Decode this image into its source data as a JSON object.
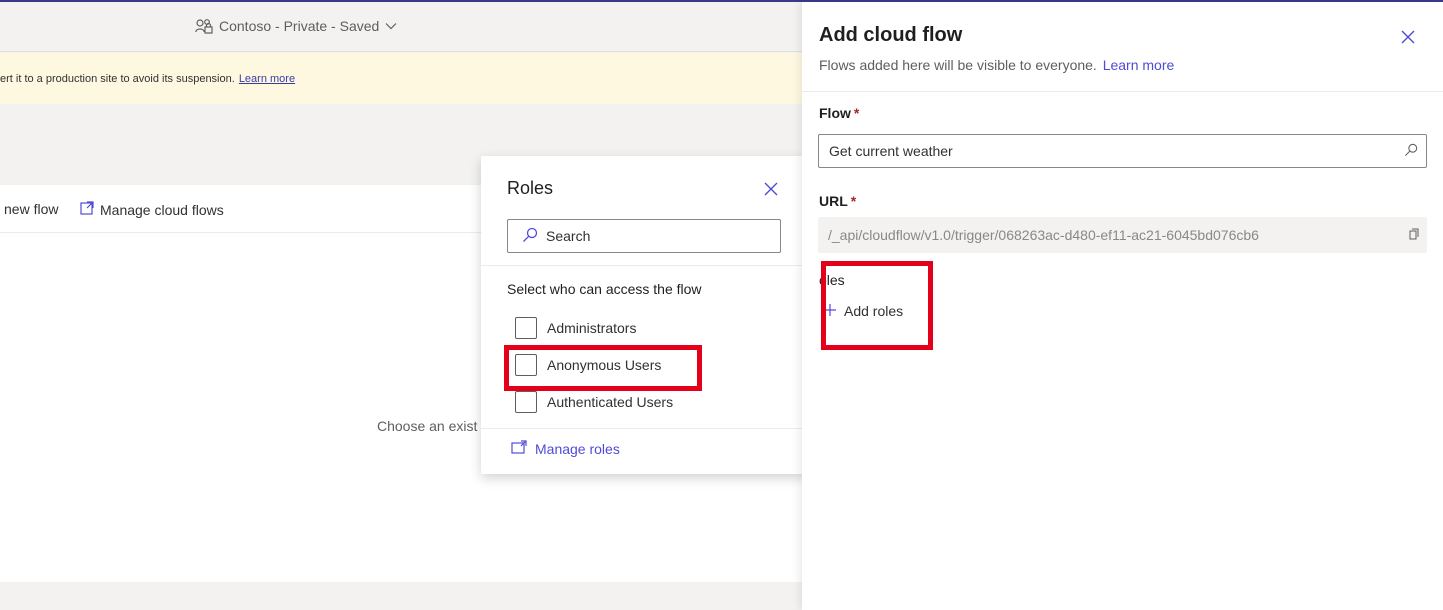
{
  "header": {
    "site_title": "Contoso - Private - Saved"
  },
  "banner": {
    "text": "ert it to a production site to avoid its suspension.",
    "link": "Learn more"
  },
  "toolbar": {
    "new_flow": "new flow",
    "manage_cloud_flows": "Manage cloud flows"
  },
  "content": {
    "empty_text": "Choose an exist"
  },
  "roles_popup": {
    "title": "Roles",
    "search_placeholder": "Search",
    "subtitle": "Select who can access the flow",
    "roles": [
      {
        "label": "Administrators",
        "checked": false
      },
      {
        "label": "Anonymous Users",
        "checked": false
      },
      {
        "label": "Authenticated Users",
        "checked": false
      }
    ],
    "manage_roles": "Manage roles"
  },
  "panel": {
    "title": "Add cloud flow",
    "subtitle": "Flows added here will be visible to everyone.",
    "subtitle_link": "Learn more",
    "flow_label": "Flow",
    "required_mark": "*",
    "flow_value": "Get current weather",
    "url_label": "URL",
    "url_value": "/_api/cloudflow/v1.0/trigger/068263ac-d480-ef11-ac21-6045bd076cb6",
    "roles_label": "oles",
    "add_roles": "Add roles"
  },
  "colors": {
    "accent": "#4f4bd9",
    "highlight": "#e3001b",
    "banner_bg": "#fff8e1"
  }
}
